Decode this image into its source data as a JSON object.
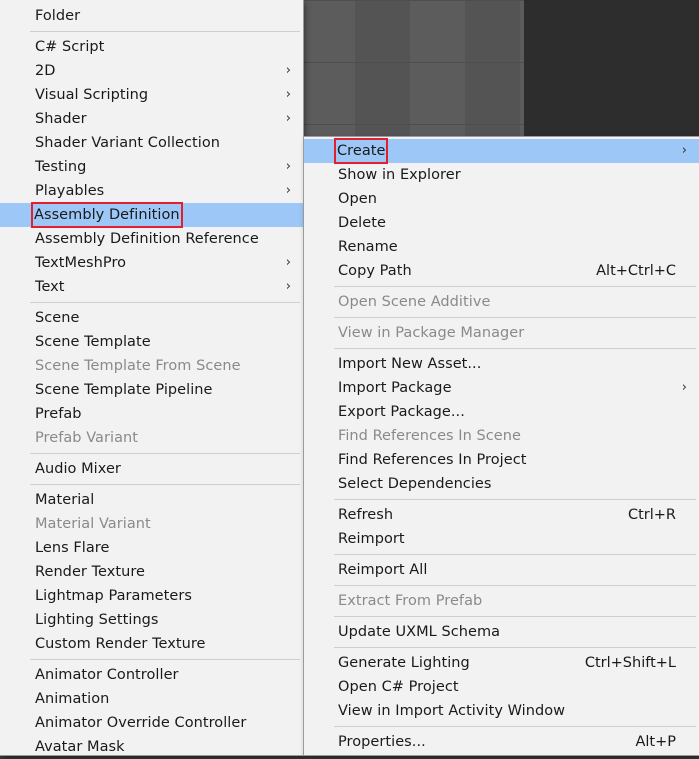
{
  "left_menu": {
    "items": [
      {
        "label": "Folder"
      },
      {
        "label": "C# Script"
      },
      {
        "label": "2D",
        "submenu": "›"
      },
      {
        "label": "Visual Scripting",
        "submenu": "›"
      },
      {
        "label": "Shader",
        "submenu": "›"
      },
      {
        "label": "Shader Variant Collection"
      },
      {
        "label": "Testing",
        "submenu": "›"
      },
      {
        "label": "Playables",
        "submenu": "›"
      },
      {
        "label": "Assembly Definition"
      },
      {
        "label": "Assembly Definition Reference"
      },
      {
        "label": "TextMeshPro",
        "submenu": "›"
      },
      {
        "label": "Text",
        "submenu": "›"
      },
      {
        "label": "Scene"
      },
      {
        "label": "Scene Template"
      },
      {
        "label": "Scene Template From Scene"
      },
      {
        "label": "Scene Template Pipeline"
      },
      {
        "label": "Prefab"
      },
      {
        "label": "Prefab Variant"
      },
      {
        "label": "Audio Mixer"
      },
      {
        "label": "Material"
      },
      {
        "label": "Material Variant"
      },
      {
        "label": "Lens Flare"
      },
      {
        "label": "Render Texture"
      },
      {
        "label": "Lightmap Parameters"
      },
      {
        "label": "Lighting Settings"
      },
      {
        "label": "Custom Render Texture"
      },
      {
        "label": "Animator Controller"
      },
      {
        "label": "Animation"
      },
      {
        "label": "Animator Override Controller"
      },
      {
        "label": "Avatar Mask"
      }
    ]
  },
  "right_menu": {
    "items": [
      {
        "label": "Create",
        "submenu": "›"
      },
      {
        "label": "Show in Explorer"
      },
      {
        "label": "Open"
      },
      {
        "label": "Delete"
      },
      {
        "label": "Rename"
      },
      {
        "label": "Copy Path",
        "shortcut": "Alt+Ctrl+C"
      },
      {
        "label": "Open Scene Additive"
      },
      {
        "label": "View in Package Manager"
      },
      {
        "label": "Import New Asset..."
      },
      {
        "label": "Import Package",
        "submenu": "›"
      },
      {
        "label": "Export Package..."
      },
      {
        "label": "Find References In Scene"
      },
      {
        "label": "Find References In Project"
      },
      {
        "label": "Select Dependencies"
      },
      {
        "label": "Refresh",
        "shortcut": "Ctrl+R"
      },
      {
        "label": "Reimport"
      },
      {
        "label": "Reimport All"
      },
      {
        "label": "Extract From Prefab"
      },
      {
        "label": "Update UXML Schema"
      },
      {
        "label": "Generate Lighting",
        "shortcut": "Ctrl+Shift+L"
      },
      {
        "label": "Open C# Project"
      },
      {
        "label": "View in Import Activity Window"
      },
      {
        "label": "Properties...",
        "shortcut": "Alt+P"
      }
    ]
  },
  "colors": {
    "menu_bg": "#f2f2f2",
    "selection": "#9cc7f7",
    "highlight_box": "#e0202d",
    "disabled_text": "#8a8a8a"
  }
}
